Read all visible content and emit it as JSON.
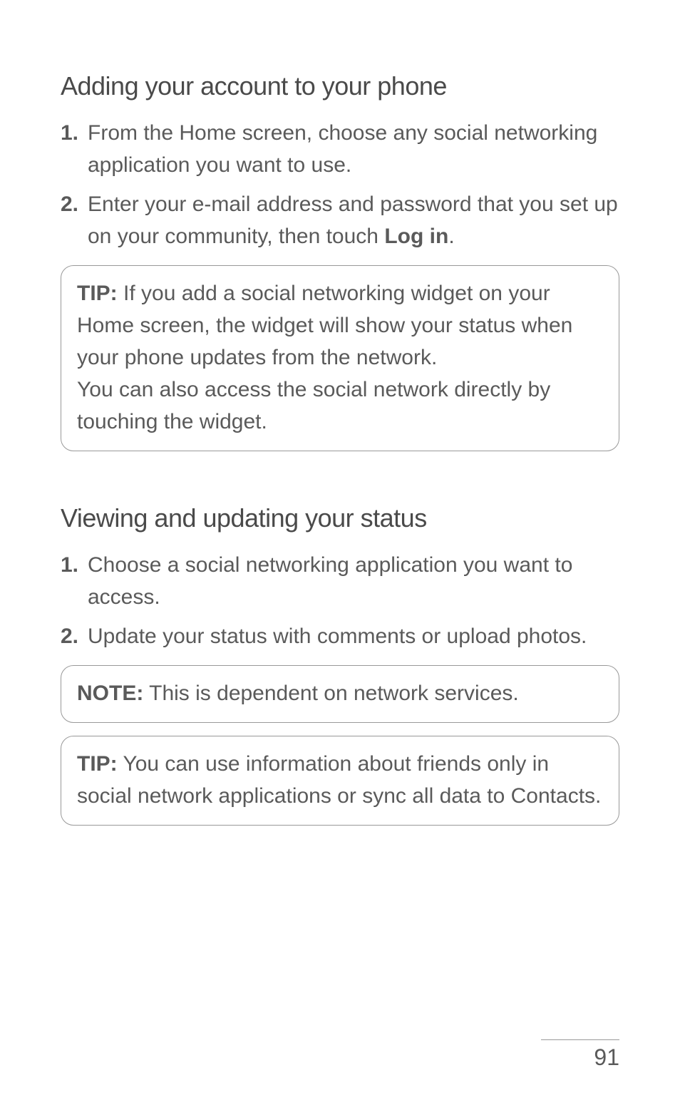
{
  "section1": {
    "heading": "Adding your account to your phone",
    "items": [
      {
        "num": "1.",
        "text": "From the Home screen, choose any social networking application you want to use."
      },
      {
        "num": "2.",
        "text_pre": "Enter your e-mail address and password that you set up on your community, then touch ",
        "text_bold": "Log in",
        "text_post": "."
      }
    ],
    "tip": {
      "label": "TIP:",
      "text1": " If you add a social networking widget on your Home screen, the widget will show your status when your phone updates from the network.",
      "text2": "You can also access the social network directly by touching the widget."
    }
  },
  "section2": {
    "heading": "Viewing and updating your status",
    "items": [
      {
        "num": "1.",
        "text": "Choose a social networking application you want to access."
      },
      {
        "num": "2.",
        "text": "Update your status with comments or upload photos."
      }
    ],
    "note": {
      "label": "NOTE:",
      "text": " This is dependent on network services."
    },
    "tip": {
      "label": "TIP:",
      "text": " You can use information about friends only in social network applications or sync all data to Contacts."
    }
  },
  "pageNumber": "91"
}
